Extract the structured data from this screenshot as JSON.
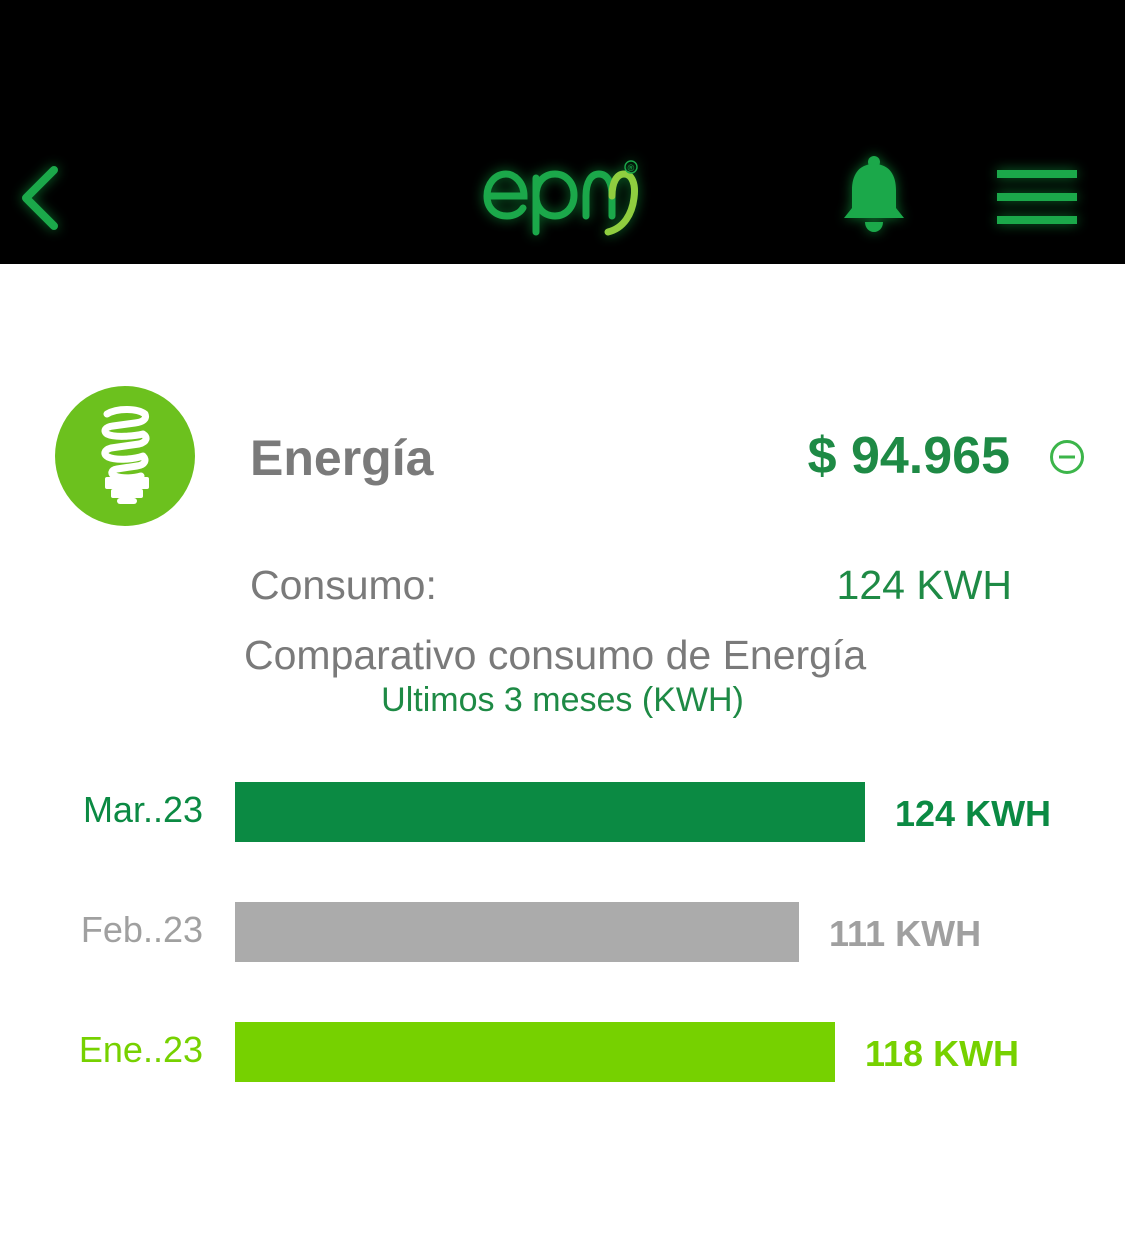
{
  "header": {
    "logo_text": "epm",
    "logo_mark": "®",
    "icons": {
      "back": "chevron-left-icon",
      "notifications": "bell-icon",
      "menu": "hamburger-menu-icon"
    },
    "accent_color": "#1ba84a"
  },
  "service": {
    "icon": "lightbulb-icon",
    "icon_color": "#6cc11e",
    "title": "Energía",
    "amount": "$ 94.965",
    "collapse_icon": "minus-circle-icon",
    "consumo_label": "Consumo:",
    "consumo_value": "124 KWH"
  },
  "chart": {
    "title": "Comparativo consumo de Energía",
    "subtitle": "Ultimos 3 meses (KWH)"
  },
  "chart_data": {
    "type": "bar",
    "orientation": "horizontal",
    "categories": [
      "Mar..23",
      "Feb..23",
      "Ene..23"
    ],
    "values": [
      124,
      111,
      118
    ],
    "value_labels": [
      "124 KWH",
      "111 KWH",
      "118 KWH"
    ],
    "colors": [
      "#0b8a43",
      "#ababab",
      "#76d100"
    ],
    "label_colors": [
      "#0b8a43",
      "#a0a0a0",
      "#76d100"
    ],
    "unit": "KWH",
    "grid": false,
    "legend": "none"
  }
}
